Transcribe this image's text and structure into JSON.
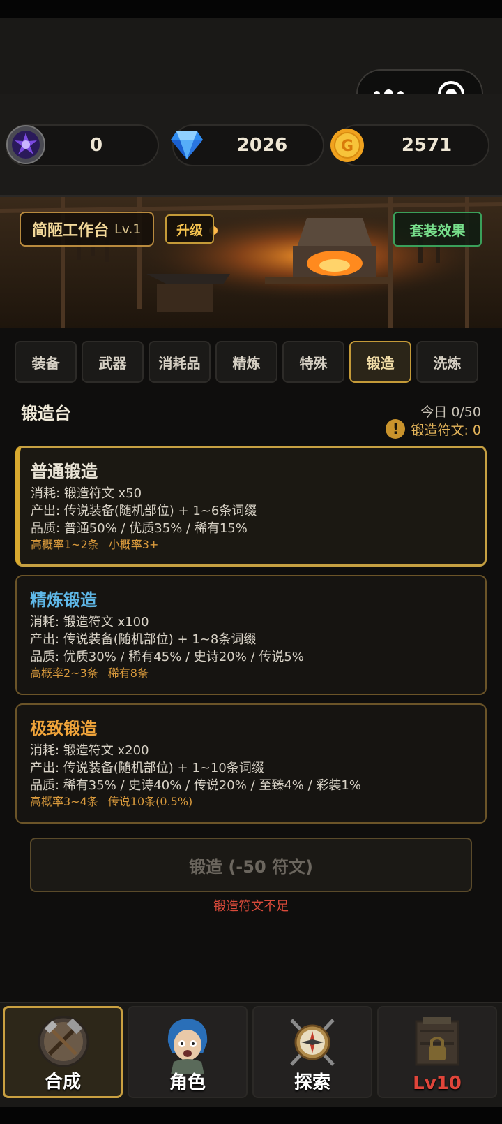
{
  "currency": {
    "rune": {
      "value": "0",
      "icon": "purple-rune-icon"
    },
    "diamond": {
      "value": "2026",
      "icon": "diamond-icon"
    },
    "gold": {
      "value": "2571",
      "icon": "gold-coin-icon",
      "glyph": "G"
    }
  },
  "workshop": {
    "name": "简陋工作台",
    "level": "Lv.1",
    "upgrade_label": "升级",
    "set_effect_label": "套装效果"
  },
  "tabs": [
    {
      "label": "装备"
    },
    {
      "label": "武器"
    },
    {
      "label": "消耗品"
    },
    {
      "label": "精炼"
    },
    {
      "label": "特殊"
    },
    {
      "label": "锻造",
      "active": true
    },
    {
      "label": "洗炼"
    }
  ],
  "forge": {
    "title": "锻造台",
    "today": "今日 0/50",
    "runes": "锻造符文: 0",
    "warn_glyph": "!",
    "options": [
      {
        "name": "普通锻造",
        "color": "#e9e3d5",
        "cost": "消耗: 锻造符文 x50",
        "output": "产出: 传说装备(随机部位) + 1~6条词缀",
        "quality": "品质: 普通50% / 优质35% / 稀有15%",
        "hint1": "高概率1~2条",
        "hint2": "小概率3+"
      },
      {
        "name": "精炼锻造",
        "color": "#5fb8e8",
        "cost": "消耗: 锻造符文 x100",
        "output": "产出: 传说装备(随机部位) + 1~8条词缀",
        "quality": "品质: 优质30% / 稀有45% / 史诗20% / 传说5%",
        "hint1": "高概率2~3条",
        "hint2": "稀有8条"
      },
      {
        "name": "极致锻造",
        "color": "#f0a43a",
        "cost": "消耗: 锻造符文 x200",
        "output": "产出: 传说装备(随机部位) + 1~10条词缀",
        "quality": "品质: 稀有35% / 史诗40% / 传说20% / 至臻4% / 彩装1%",
        "hint1": "高概率3~4条",
        "hint2": "传说10条(0.5%)"
      }
    ],
    "button_label": "锻造 (-50 符文)",
    "insufficient": "锻造符文不足"
  },
  "nav": [
    {
      "label": "合成",
      "icon": "crafting-tools-icon",
      "active": true
    },
    {
      "label": "角色",
      "icon": "character-portrait-icon"
    },
    {
      "label": "探索",
      "icon": "compass-swords-icon"
    },
    {
      "label": "Lv10",
      "icon": "locked-shop-icon",
      "locked": true
    }
  ]
}
